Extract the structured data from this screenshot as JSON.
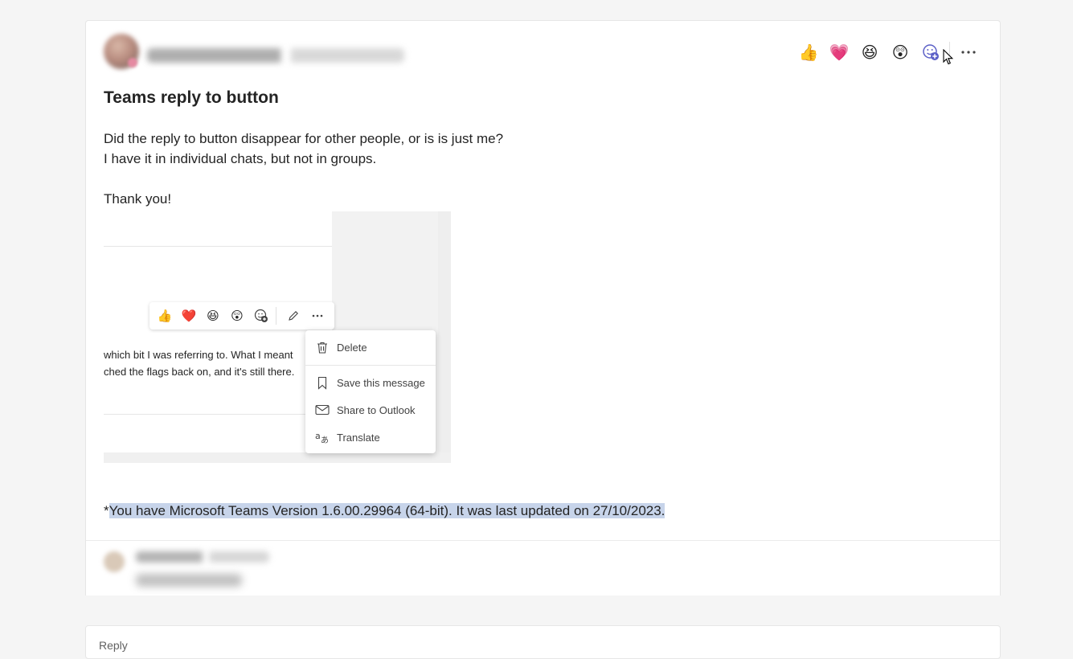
{
  "post": {
    "title": "Teams reply to button",
    "body_lines": [
      "Did the reply to button disappear for other people, or is is just me?",
      "I have it in individual chats, but not in groups.",
      "",
      "Thank you!"
    ],
    "footnote_prefix": "*",
    "footnote_selected": "You have Microsoft Teams Version 1.6.00.29964 (64-bit). It was last updated on 27/10/2023."
  },
  "reactions": [
    {
      "icon": "thumbs-up-icon",
      "glyph": "👍"
    },
    {
      "icon": "heart-icon",
      "glyph": "💗"
    },
    {
      "icon": "laugh-icon",
      "glyph": "😆"
    },
    {
      "icon": "surprised-icon",
      "glyph": "😲"
    }
  ],
  "embedded_screenshot": {
    "message_lines": [
      "which bit I was referring to. What I meant",
      "ched the flags back on, and it's still there."
    ],
    "toolbar_reactions": [
      {
        "icon": "thumbs-up-icon",
        "glyph": "👍"
      },
      {
        "icon": "heart-icon",
        "glyph": "❤️"
      },
      {
        "icon": "laugh-icon",
        "glyph": "😆"
      },
      {
        "icon": "surprised-icon",
        "glyph": "😲"
      }
    ],
    "menu": {
      "delete": "Delete",
      "save": "Save this message",
      "share": "Share to Outlook",
      "translate": "Translate"
    }
  },
  "reply_box": {
    "label": "Reply"
  },
  "colors": {
    "selection": "#c7d4ea",
    "accent": "#5b5fc7"
  }
}
